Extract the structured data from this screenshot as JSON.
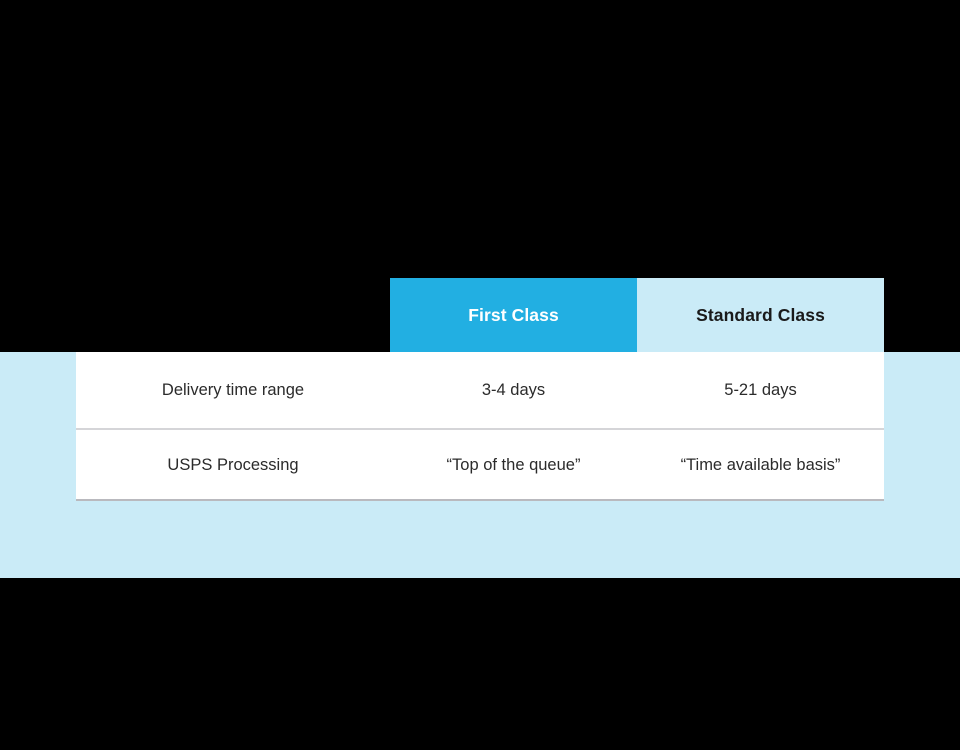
{
  "colors": {
    "background": "#000000",
    "band": "#CAEBF7",
    "primary_header": "#22AFE2",
    "secondary_header": "#CAEBF7",
    "primary_header_text": "#FFFFFF",
    "secondary_header_text": "#1A1A1A",
    "table_background": "#FFFFFF",
    "row_divider": "#D5D5D8",
    "table_bottom_border": "#B9B9BE",
    "body_text": "#2B2B2B"
  },
  "table": {
    "corner_label": "",
    "columns": [
      {
        "label": "First Class",
        "style": "primary"
      },
      {
        "label": "Standard Class",
        "style": "secondary"
      }
    ],
    "rows": [
      {
        "label": "Delivery time range",
        "values": [
          "3-4 days",
          "5-21 days"
        ]
      },
      {
        "label": "USPS Processing",
        "values": [
          "“Top of the queue”",
          "“Time available basis”"
        ]
      }
    ]
  }
}
